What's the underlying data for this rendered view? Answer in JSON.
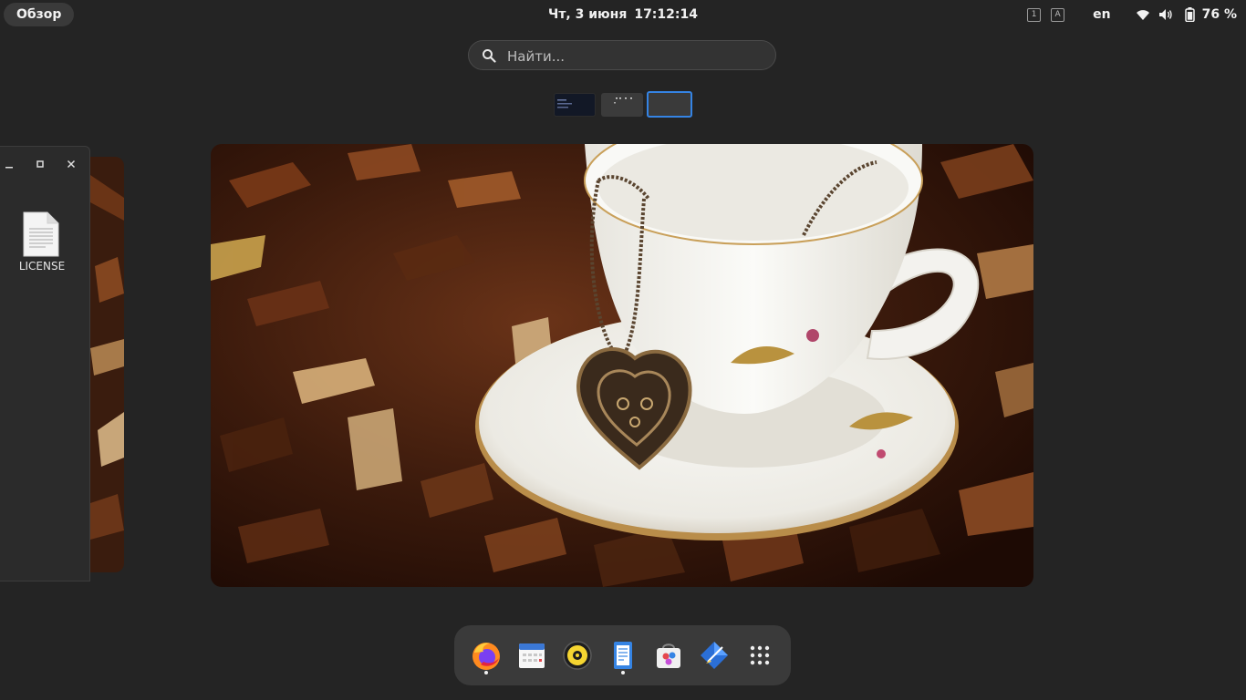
{
  "topbar": {
    "activities_label": "Обзор",
    "date": "Чт, 3 июня",
    "time": "17:12:14",
    "kbd_indicators": [
      "1",
      "A"
    ],
    "language": "en",
    "battery_percent": "76 %"
  },
  "search": {
    "placeholder": "Найти..."
  },
  "workspaces": {
    "count": 3,
    "active_index": 2
  },
  "files_window": {
    "file_label": "LICENSE"
  },
  "dock": {
    "items": [
      "firefox-icon",
      "calendar-icon",
      "rhythmbox-icon",
      "text-editor-icon",
      "software-icon",
      "paint-icon",
      "show-apps-icon"
    ],
    "running": [
      "firefox-icon",
      "text-editor-icon"
    ]
  },
  "colors": {
    "accent": "#3584e4",
    "panel": "#242424"
  }
}
